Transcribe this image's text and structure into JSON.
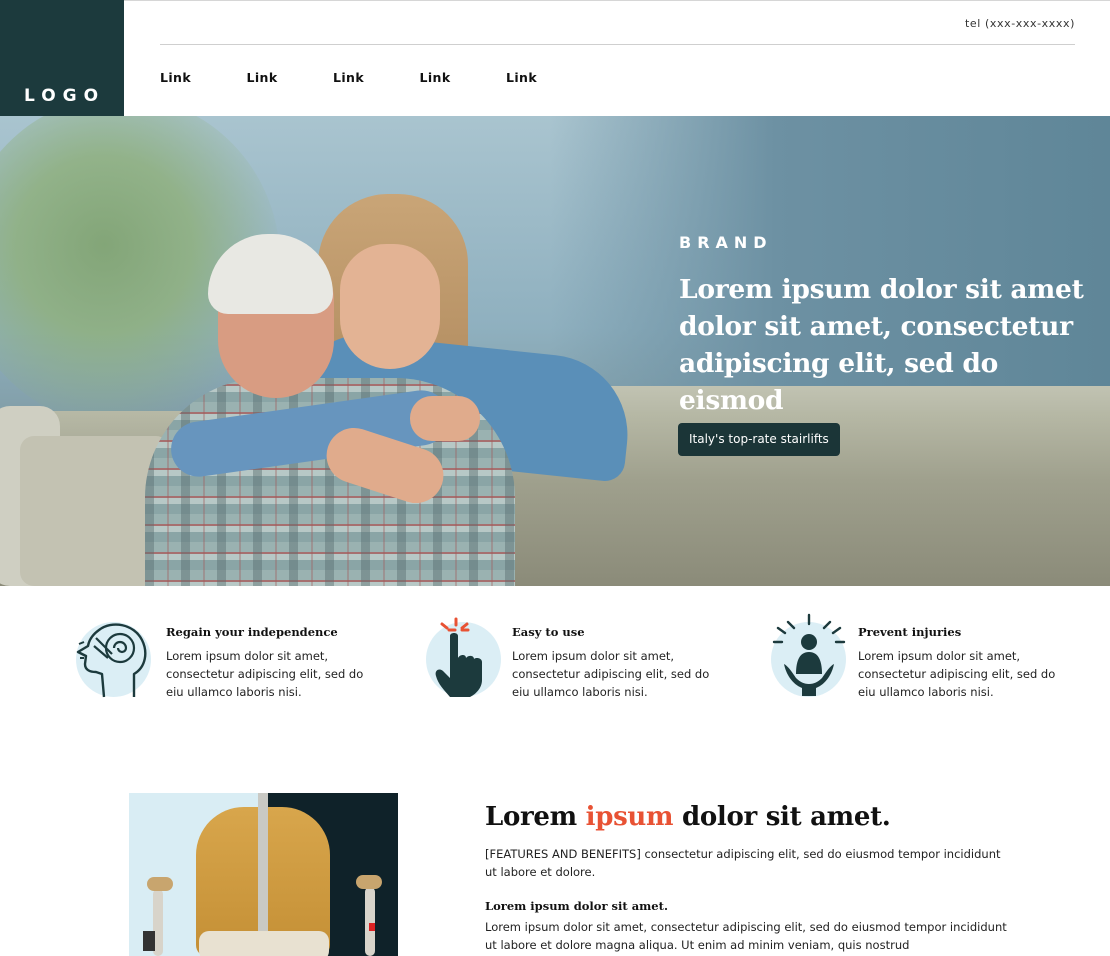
{
  "header": {
    "logo": "LOGO",
    "tel": "tel (xxx-xxx-xxxx)",
    "nav": [
      "Link",
      "Link",
      "Link",
      "Link",
      "Link"
    ]
  },
  "hero": {
    "brand": "BRAND",
    "headline": "Lorem ipsum dolor sit amet dolor sit amet, consectetur adipiscing elit, sed do eismod",
    "cta": "Italy's top-rate stairlifts"
  },
  "features": [
    {
      "icon": "brain-head-icon",
      "title": "Regain your independence",
      "body": "Lorem ipsum dolor sit amet, consectetur adipiscing elit, sed do eiu ullamco laboris nisi."
    },
    {
      "icon": "tap-hand-icon",
      "title": "Easy to use",
      "body": "Lorem ipsum dolor sit amet, consectetur adipiscing elit, sed do eiu ullamco laboris nisi."
    },
    {
      "icon": "protected-person-icon",
      "title": "Prevent injuries",
      "body": "Lorem ipsum dolor sit amet, consectetur adipiscing elit, sed do eiu ullamco laboris nisi."
    }
  ],
  "product": {
    "title_before": "Lorem ",
    "title_accent": "ipsum",
    "title_after": " dolor sit amet.",
    "lead": "[FEATURES AND BENEFITS] consectetur adipiscing elit, sed do eiusmod tempor incididunt ut labore et dolore.",
    "subtitle": "Lorem ipsum dolor sit amet.",
    "body": "Lorem ipsum dolor sit amet, consectetur adipiscing elit, sed  do eiusmod tempor incididunt ut labore et dolore magna aliqua. Ut enim ad minim veniam, quis nostrud"
  },
  "colors": {
    "dark_teal": "#1c3a3d",
    "accent": "#e85234",
    "icon_bg": "#dbeef5"
  }
}
